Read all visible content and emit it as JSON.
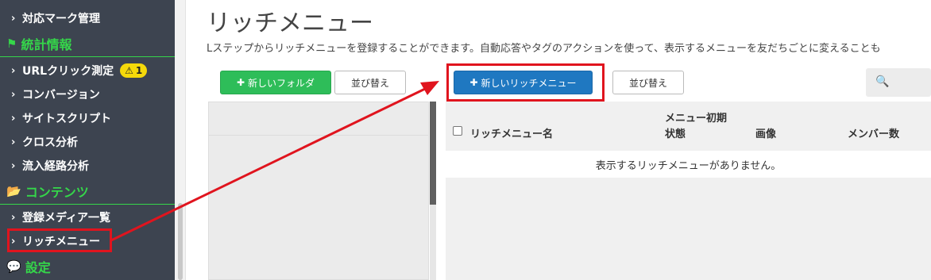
{
  "sidebar": {
    "items": [
      {
        "label": "対応マーク管理"
      },
      {
        "label": "URLクリック測定",
        "badge": "1"
      },
      {
        "label": "コンバージョン"
      },
      {
        "label": "サイトスクリプト"
      },
      {
        "label": "クロス分析"
      },
      {
        "label": "流入経路分析"
      },
      {
        "label": "登録メディア一覧"
      },
      {
        "label": "リッチメニュー"
      }
    ],
    "sections": [
      {
        "label": "統計情報"
      },
      {
        "label": "コンテンツ"
      },
      {
        "label": "設定"
      }
    ]
  },
  "main": {
    "title": "リッチメニュー",
    "description": "Lステップからリッチメニューを登録することができます。自動応答やタグのアクションを使って、表示するメニューを友だちごとに変えることも",
    "buttons": {
      "new_folder": "新しいフォルダ",
      "sort_folders": "並び替え",
      "new_rich_menu": "新しいリッチメニュー",
      "sort_menus": "並び替え"
    },
    "table": {
      "headers": {
        "name": "リッチメニュー名",
        "initial_top": "メニュー初期",
        "status": "状態",
        "image": "画像",
        "members": "メンバー数"
      },
      "empty_message": "表示するリッチメニューがありません。"
    }
  },
  "colors": {
    "sidebar_bg": "#3d4450",
    "section_green": "#35d64a",
    "primary_blue": "#1f78c1",
    "success_green": "#2ebd59",
    "annotation_red": "#e0141e",
    "warning_yellow": "#f5d90a"
  },
  "icons": {
    "flag": "flag-icon",
    "folder": "folder-open-icon",
    "chat": "chat-icon",
    "warning": "warning-icon",
    "search": "search-icon",
    "chevron": "chevron-right-icon",
    "plus": "plus-icon"
  }
}
